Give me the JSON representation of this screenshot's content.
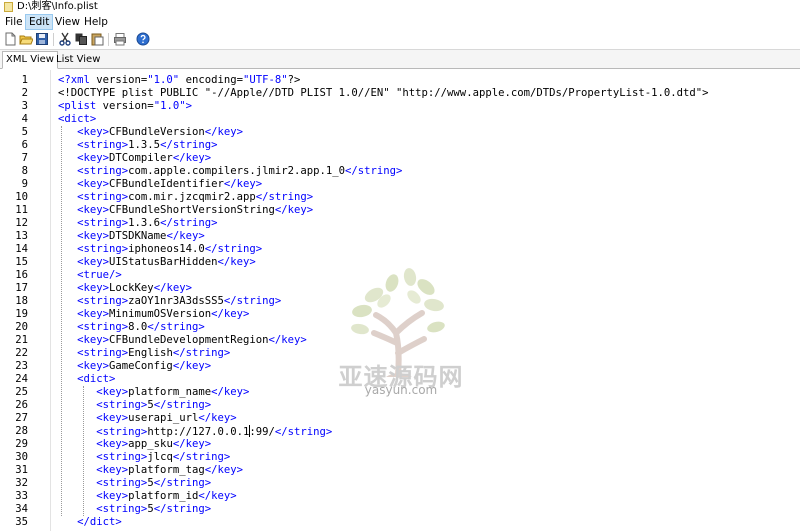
{
  "window": {
    "title": "D:\\刺客\\Info.plist"
  },
  "menu": [
    "File",
    "Edit",
    "View",
    "Help"
  ],
  "tabs": [
    "XML View",
    "List View"
  ],
  "watermark": {
    "brand": "亚速源码网",
    "domain": "yasyun.com"
  },
  "lines": [
    {
      "n": "1",
      "segs": [
        {
          "c": "tag",
          "t": "<?xml"
        },
        {
          "c": "",
          "t": " version="
        },
        {
          "c": "tag",
          "t": "\"1.0\""
        },
        {
          "c": "",
          "t": " encoding="
        },
        {
          "c": "tag",
          "t": "\"UTF-8\""
        },
        {
          "c": "",
          "t": "?>"
        }
      ]
    },
    {
      "n": "2",
      "segs": [
        {
          "c": "",
          "t": "<!DOCTYPE plist PUBLIC \"-//Apple//DTD PLIST 1.0//EN\" \"http://www.apple.com/DTDs/PropertyList-1.0.dtd\">"
        }
      ]
    },
    {
      "n": "3",
      "segs": [
        {
          "c": "tag",
          "t": "<plist"
        },
        {
          "c": "",
          "t": " version="
        },
        {
          "c": "tag",
          "t": "\"1.0\">"
        }
      ]
    },
    {
      "n": "4",
      "segs": [
        {
          "c": "tag",
          "t": "<dict>"
        }
      ]
    },
    {
      "n": "5",
      "segs": [
        {
          "c": "",
          "t": "   "
        },
        {
          "c": "tag",
          "t": "<key>"
        },
        {
          "c": "",
          "t": "CFBundleVersion"
        },
        {
          "c": "tag",
          "t": "</key>"
        }
      ]
    },
    {
      "n": "6",
      "segs": [
        {
          "c": "",
          "t": "   "
        },
        {
          "c": "tag",
          "t": "<string>"
        },
        {
          "c": "",
          "t": "1.3.5"
        },
        {
          "c": "tag",
          "t": "</string>"
        }
      ]
    },
    {
      "n": "7",
      "segs": [
        {
          "c": "",
          "t": "   "
        },
        {
          "c": "tag",
          "t": "<key>"
        },
        {
          "c": "",
          "t": "DTCompiler"
        },
        {
          "c": "tag",
          "t": "</key>"
        }
      ]
    },
    {
      "n": "8",
      "segs": [
        {
          "c": "",
          "t": "   "
        },
        {
          "c": "tag",
          "t": "<string>"
        },
        {
          "c": "",
          "t": "com.apple.compilers.jlmir2.app.1_0"
        },
        {
          "c": "tag",
          "t": "</string>"
        }
      ]
    },
    {
      "n": "9",
      "segs": [
        {
          "c": "",
          "t": "   "
        },
        {
          "c": "tag",
          "t": "<key>"
        },
        {
          "c": "",
          "t": "CFBundleIdentifier"
        },
        {
          "c": "tag",
          "t": "</key>"
        }
      ]
    },
    {
      "n": "10",
      "segs": [
        {
          "c": "",
          "t": "   "
        },
        {
          "c": "tag",
          "t": "<string>"
        },
        {
          "c": "",
          "t": "com.mir.jzcqmir2.app"
        },
        {
          "c": "tag",
          "t": "</string>"
        }
      ]
    },
    {
      "n": "11",
      "segs": [
        {
          "c": "",
          "t": "   "
        },
        {
          "c": "tag",
          "t": "<key>"
        },
        {
          "c": "",
          "t": "CFBundleShortVersionString"
        },
        {
          "c": "tag",
          "t": "</key>"
        }
      ]
    },
    {
      "n": "12",
      "segs": [
        {
          "c": "",
          "t": "   "
        },
        {
          "c": "tag",
          "t": "<string>"
        },
        {
          "c": "",
          "t": "1.3.6"
        },
        {
          "c": "tag",
          "t": "</string>"
        }
      ]
    },
    {
      "n": "13",
      "segs": [
        {
          "c": "",
          "t": "   "
        },
        {
          "c": "tag",
          "t": "<key>"
        },
        {
          "c": "",
          "t": "DTSDKName"
        },
        {
          "c": "tag",
          "t": "</key>"
        }
      ]
    },
    {
      "n": "14",
      "segs": [
        {
          "c": "",
          "t": "   "
        },
        {
          "c": "tag",
          "t": "<string>"
        },
        {
          "c": "",
          "t": "iphoneos14.0"
        },
        {
          "c": "tag",
          "t": "</string>"
        }
      ]
    },
    {
      "n": "15",
      "segs": [
        {
          "c": "",
          "t": "   "
        },
        {
          "c": "tag",
          "t": "<key>"
        },
        {
          "c": "",
          "t": "UIStatusBarHidden"
        },
        {
          "c": "tag",
          "t": "</key>"
        }
      ]
    },
    {
      "n": "16",
      "segs": [
        {
          "c": "",
          "t": "   "
        },
        {
          "c": "tag",
          "t": "<true/>"
        }
      ]
    },
    {
      "n": "17",
      "segs": [
        {
          "c": "",
          "t": "   "
        },
        {
          "c": "tag",
          "t": "<key>"
        },
        {
          "c": "",
          "t": "LockKey"
        },
        {
          "c": "tag",
          "t": "</key>"
        }
      ]
    },
    {
      "n": "18",
      "segs": [
        {
          "c": "",
          "t": "   "
        },
        {
          "c": "tag",
          "t": "<string>"
        },
        {
          "c": "",
          "t": "zaOY1nr3A3dsSS5"
        },
        {
          "c": "tag",
          "t": "</string>"
        }
      ]
    },
    {
      "n": "19",
      "segs": [
        {
          "c": "",
          "t": "   "
        },
        {
          "c": "tag",
          "t": "<key>"
        },
        {
          "c": "",
          "t": "MinimumOSVersion"
        },
        {
          "c": "tag",
          "t": "</key>"
        }
      ]
    },
    {
      "n": "20",
      "segs": [
        {
          "c": "",
          "t": "   "
        },
        {
          "c": "tag",
          "t": "<string>"
        },
        {
          "c": "",
          "t": "8.0"
        },
        {
          "c": "tag",
          "t": "</string>"
        }
      ]
    },
    {
      "n": "21",
      "segs": [
        {
          "c": "",
          "t": "   "
        },
        {
          "c": "tag",
          "t": "<key>"
        },
        {
          "c": "",
          "t": "CFBundleDevelopmentRegion"
        },
        {
          "c": "tag",
          "t": "</key>"
        }
      ]
    },
    {
      "n": "22",
      "segs": [
        {
          "c": "",
          "t": "   "
        },
        {
          "c": "tag",
          "t": "<string>"
        },
        {
          "c": "",
          "t": "English"
        },
        {
          "c": "tag",
          "t": "</string>"
        }
      ]
    },
    {
      "n": "23",
      "segs": [
        {
          "c": "",
          "t": "   "
        },
        {
          "c": "tag",
          "t": "<key>"
        },
        {
          "c": "",
          "t": "GameConfig"
        },
        {
          "c": "tag",
          "t": "</key>"
        }
      ]
    },
    {
      "n": "24",
      "segs": [
        {
          "c": "",
          "t": "   "
        },
        {
          "c": "tag",
          "t": "<dict>"
        }
      ]
    },
    {
      "n": "25",
      "segs": [
        {
          "c": "",
          "t": "      "
        },
        {
          "c": "tag",
          "t": "<key>"
        },
        {
          "c": "",
          "t": "platform_name"
        },
        {
          "c": "tag",
          "t": "</key>"
        }
      ]
    },
    {
      "n": "26",
      "segs": [
        {
          "c": "",
          "t": "      "
        },
        {
          "c": "tag",
          "t": "<string>"
        },
        {
          "c": "",
          "t": "5"
        },
        {
          "c": "tag",
          "t": "</string>"
        }
      ]
    },
    {
      "n": "27",
      "segs": [
        {
          "c": "",
          "t": "      "
        },
        {
          "c": "tag",
          "t": "<key>"
        },
        {
          "c": "",
          "t": "userapi_url"
        },
        {
          "c": "tag",
          "t": "</key>"
        }
      ]
    },
    {
      "n": "28",
      "segs": [
        {
          "c": "",
          "t": "      "
        },
        {
          "c": "tag",
          "t": "<string>"
        },
        {
          "c": "",
          "t": "http://127.0.0.1"
        },
        {
          "c": "cursor",
          "t": ""
        },
        {
          "c": "",
          "t": ":99/"
        },
        {
          "c": "tag",
          "t": "</string>"
        }
      ]
    },
    {
      "n": "29",
      "segs": [
        {
          "c": "",
          "t": "      "
        },
        {
          "c": "tag",
          "t": "<key>"
        },
        {
          "c": "",
          "t": "app_sku"
        },
        {
          "c": "tag",
          "t": "</key>"
        }
      ]
    },
    {
      "n": "30",
      "segs": [
        {
          "c": "",
          "t": "      "
        },
        {
          "c": "tag",
          "t": "<string>"
        },
        {
          "c": "",
          "t": "jlcq"
        },
        {
          "c": "tag",
          "t": "</string>"
        }
      ]
    },
    {
      "n": "31",
      "segs": [
        {
          "c": "",
          "t": "      "
        },
        {
          "c": "tag",
          "t": "<key>"
        },
        {
          "c": "",
          "t": "platform_tag"
        },
        {
          "c": "tag",
          "t": "</key>"
        }
      ]
    },
    {
      "n": "32",
      "segs": [
        {
          "c": "",
          "t": "      "
        },
        {
          "c": "tag",
          "t": "<string>"
        },
        {
          "c": "",
          "t": "5"
        },
        {
          "c": "tag",
          "t": "</string>"
        }
      ]
    },
    {
      "n": "33",
      "segs": [
        {
          "c": "",
          "t": "      "
        },
        {
          "c": "tag",
          "t": "<key>"
        },
        {
          "c": "",
          "t": "platform_id"
        },
        {
          "c": "tag",
          "t": "</key>"
        }
      ]
    },
    {
      "n": "34",
      "segs": [
        {
          "c": "",
          "t": "      "
        },
        {
          "c": "tag",
          "t": "<string>"
        },
        {
          "c": "",
          "t": "5"
        },
        {
          "c": "tag",
          "t": "</string>"
        }
      ]
    },
    {
      "n": "35",
      "segs": [
        {
          "c": "",
          "t": "   "
        },
        {
          "c": "tag",
          "t": "</dict>"
        }
      ]
    }
  ]
}
